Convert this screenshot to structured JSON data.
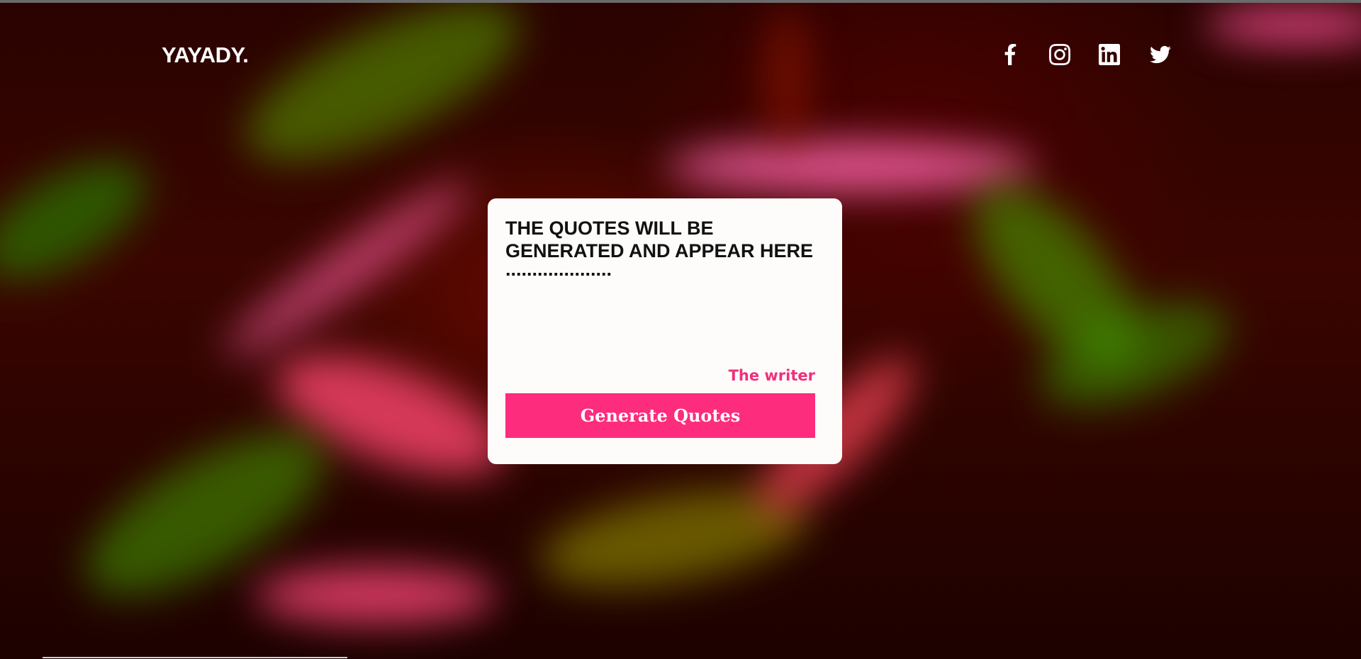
{
  "brand": {
    "name": "YAYADY."
  },
  "socials": [
    {
      "icon": "facebook-icon"
    },
    {
      "icon": "instagram-icon"
    },
    {
      "icon": "linkedin-icon"
    },
    {
      "icon": "twitter-icon"
    }
  ],
  "card": {
    "quote": "THE QUOTES WILL BE GENERATED AND APPEAR HERE",
    "ellipsis": "....................",
    "writer": "The writer",
    "button_label": "Generate Quotes"
  },
  "colors": {
    "accent": "#fd2c7d",
    "writer": "#f0307a",
    "card_bg": "#fdfcfa"
  }
}
